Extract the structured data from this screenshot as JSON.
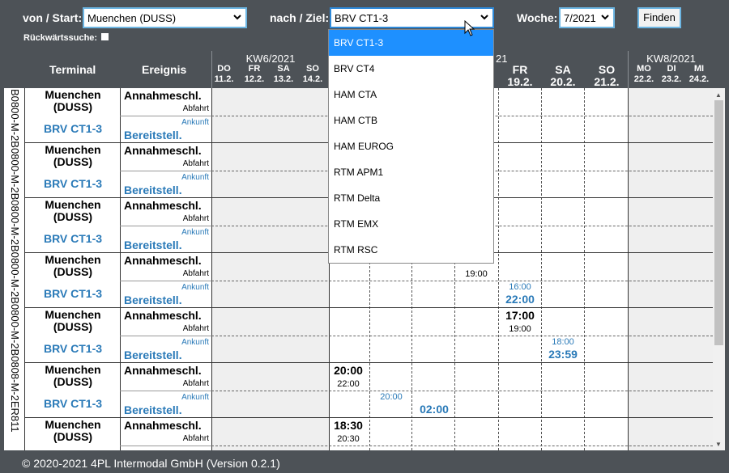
{
  "search": {
    "from_label": "von / Start:",
    "from_value": "Muenchen (DUSS)",
    "to_label": "nach / Ziel:",
    "to_value": "BRV CT1-3",
    "week_label": "Woche:",
    "week_value": "7/2021",
    "find_button": "Finden",
    "reverse_label": "Rückwärtssuche:"
  },
  "table_header": {
    "terminal": "Terminal",
    "event": "Ereignis",
    "weeks": [
      {
        "label": "KW6/2021",
        "days": [
          [
            "DO",
            "11.2."
          ],
          [
            "FR",
            "12.2."
          ],
          [
            "SA",
            "13.2."
          ],
          [
            "SO",
            "14.2."
          ]
        ]
      },
      {
        "label": "KW7/2021",
        "days": [
          [
            "FR",
            "19.2."
          ],
          [
            "SA",
            "20.2."
          ],
          [
            "SO",
            "21.2."
          ]
        ]
      },
      {
        "label": "KW8/2021",
        "days": [
          [
            "MO",
            "22.2."
          ],
          [
            "DI",
            "23.2."
          ],
          [
            "MI",
            "24.2."
          ]
        ]
      }
    ],
    "kw7_visible_suffix": "21"
  },
  "row_ids": "B0800-M-2B0800-M-2B0800-M-2B0800-M-2B0800-M-2B0808-M-2ER811",
  "rows": [
    {
      "origin": "Muenchen",
      "origin_code": "(DUSS)",
      "dest": "BRV CT1-3",
      "ev_top": "Annahmeschl.",
      "ev_top_sub": "Abfahrt",
      "ev_bottom_sub": "Ankunft",
      "ev_bottom": "Bereitstell."
    },
    {
      "origin": "Muenchen",
      "origin_code": "(DUSS)",
      "dest": "BRV CT1-3",
      "ev_top": "Annahmeschl.",
      "ev_top_sub": "Abfahrt",
      "ev_bottom_sub": "Ankunft",
      "ev_bottom": "Bereitstell."
    },
    {
      "origin": "Muenchen",
      "origin_code": "(DUSS)",
      "dest": "BRV CT1-3",
      "ev_top": "Annahmeschl.",
      "ev_top_sub": "Abfahrt",
      "ev_bottom_sub": "Ankunft",
      "ev_bottom": "Bereitstell."
    },
    {
      "origin": "Muenchen",
      "origin_code": "(DUSS)",
      "dest": "BRV CT1-3",
      "ev_top": "Annahmeschl.",
      "ev_top_sub": "Abfahrt",
      "ev_bottom_sub": "Ankunft",
      "ev_bottom": "Bereitstell."
    },
    {
      "origin": "Muenchen",
      "origin_code": "(DUSS)",
      "dest": "BRV CT1-3",
      "ev_top": "Annahmeschl.",
      "ev_top_sub": "Abfahrt",
      "ev_bottom_sub": "Ankunft",
      "ev_bottom": "Bereitstell."
    },
    {
      "origin": "Muenchen",
      "origin_code": "(DUSS)",
      "dest": "BRV CT1-3",
      "ev_top": "Annahmeschl.",
      "ev_top_sub": "Abfahrt",
      "ev_bottom_sub": "Ankunft",
      "ev_bottom": "Bereitstell."
    },
    {
      "origin": "Muenchen",
      "origin_code": "(DUSS)",
      "ev_top": "Annahmeschl.",
      "ev_top_sub": "Abfahrt"
    }
  ],
  "times": {
    "r4_fr_abfahrt": "19:00",
    "r4_fr2_ankunft": "16:00",
    "r4_fr2_bereit": "22:00",
    "r5_fr_annahme": "17:00",
    "r5_fr_abfahrt": "19:00",
    "r5_sa_ankunft": "18:00",
    "r5_sa_bereit": "23:59",
    "r6_c1_annahme": "20:00",
    "r6_c1_abfahrt": "22:00",
    "r6_c2_ankunft": "20:00",
    "r6_c3_bereit": "02:00",
    "r7_c1_annahme": "18:30",
    "r7_c1_abfahrt": "20:30"
  },
  "dropdown_options": [
    "BRV CT1-3",
    "BRV CT4",
    "HAM CTA",
    "HAM CTB",
    "HAM EUROG",
    "RTM APM1",
    "RTM Delta",
    "RTM EMX",
    "RTM RSC"
  ],
  "footer": "© 2020-2021 4PL Intermodal GmbH (Version 0.2.1)"
}
